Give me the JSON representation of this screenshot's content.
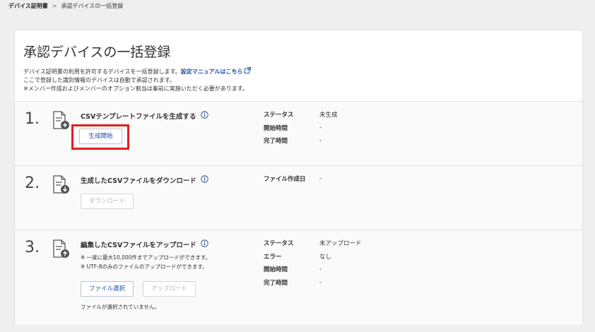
{
  "breadcrumb": {
    "parent": "デバイス証明書",
    "separator": ">",
    "current": "承認デバイスの一括登録"
  },
  "page": {
    "title": "承認デバイスの一括登録",
    "desc_line1_prefix": "デバイス証明書の利用を許可するデバイスを一括登録します。",
    "desc_link": "設定マニュアルはこちら",
    "desc_line2": "ここで登録した識別情報のデバイスは自動で承認されます。",
    "desc_line3": "※メンバー作成およびメンバーのオプション割当は事前に実施いただく必要があります。"
  },
  "steps": [
    {
      "number": "1.",
      "title": "CSVテンプレートファイルを生成する",
      "button": "生成開始",
      "status": [
        {
          "key": "ステータス",
          "value": "未生成"
        },
        {
          "key": "開始時間",
          "value": "-"
        },
        {
          "key": "完了時間",
          "value": "-"
        }
      ]
    },
    {
      "number": "2.",
      "title": "生成したCSVファイルをダウンロード",
      "button": "ダウンロード",
      "status": [
        {
          "key": "ファイル作成日",
          "value": "-"
        }
      ]
    },
    {
      "number": "3.",
      "title": "編集したCSVファイルをアップロード",
      "note1": "※ 一度に最大10,000件までアップロードができます。",
      "note2": "※ UTF-8のみのファイルのアップロードができます。",
      "select_button": "ファイル選択",
      "upload_button": "アップロード",
      "file_status": "ファイルが選択されていません。",
      "status": [
        {
          "key": "ステータス",
          "value": "未アップロード"
        },
        {
          "key": "エラー",
          "value": "なし"
        },
        {
          "key": "開始時間",
          "value": "-"
        },
        {
          "key": "完了時間",
          "value": "-"
        }
      ]
    }
  ],
  "colors": {
    "link": "#1a4fa8",
    "highlight": "#e41e1e",
    "background": "#efefef"
  },
  "icons": [
    "external-link-icon",
    "info-icon",
    "document-plus-icon",
    "document-download-icon",
    "document-upload-icon"
  ]
}
